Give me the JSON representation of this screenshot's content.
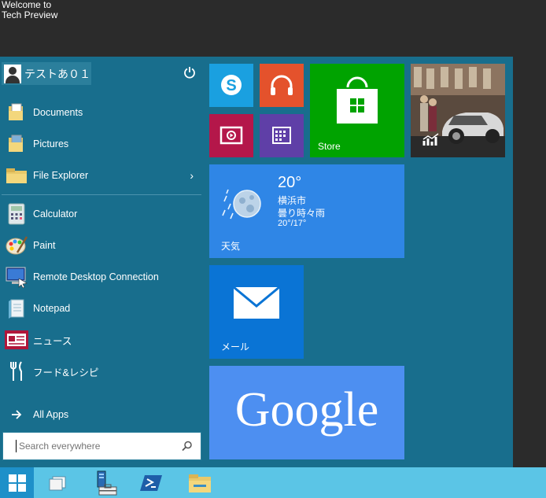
{
  "desktop": {
    "welcome_line1": "Welcome to",
    "welcome_line2": "Tech Preview"
  },
  "user": {
    "name": "テストあ０１"
  },
  "left_items": [
    {
      "label": "Documents"
    },
    {
      "label": "Pictures"
    },
    {
      "label": "File Explorer"
    },
    {
      "label": "Calculator"
    },
    {
      "label": "Paint"
    },
    {
      "label": "Remote Desktop Connection"
    },
    {
      "label": "Notepad"
    },
    {
      "label": "ニュース"
    },
    {
      "label": "フード&レシピ"
    }
  ],
  "all_apps": {
    "label": "All Apps"
  },
  "search": {
    "placeholder": "Search everywhere"
  },
  "tiles": {
    "store": {
      "label": "Store",
      "color": "#00a300"
    },
    "weather": {
      "label": "天気",
      "temp": "20°",
      "city": "横浜市",
      "condition": "曇り時々雨",
      "range": "20°/17°",
      "color": "#2f86e6"
    },
    "mail": {
      "label": "メール",
      "color": "#0a74d5"
    },
    "google": {
      "label": "Google",
      "color": "#4d8ff1"
    }
  },
  "colors": {
    "start_bg": "#186e8d",
    "taskbar": "#5bc5e6",
    "desktop": "#2b2b2b"
  }
}
